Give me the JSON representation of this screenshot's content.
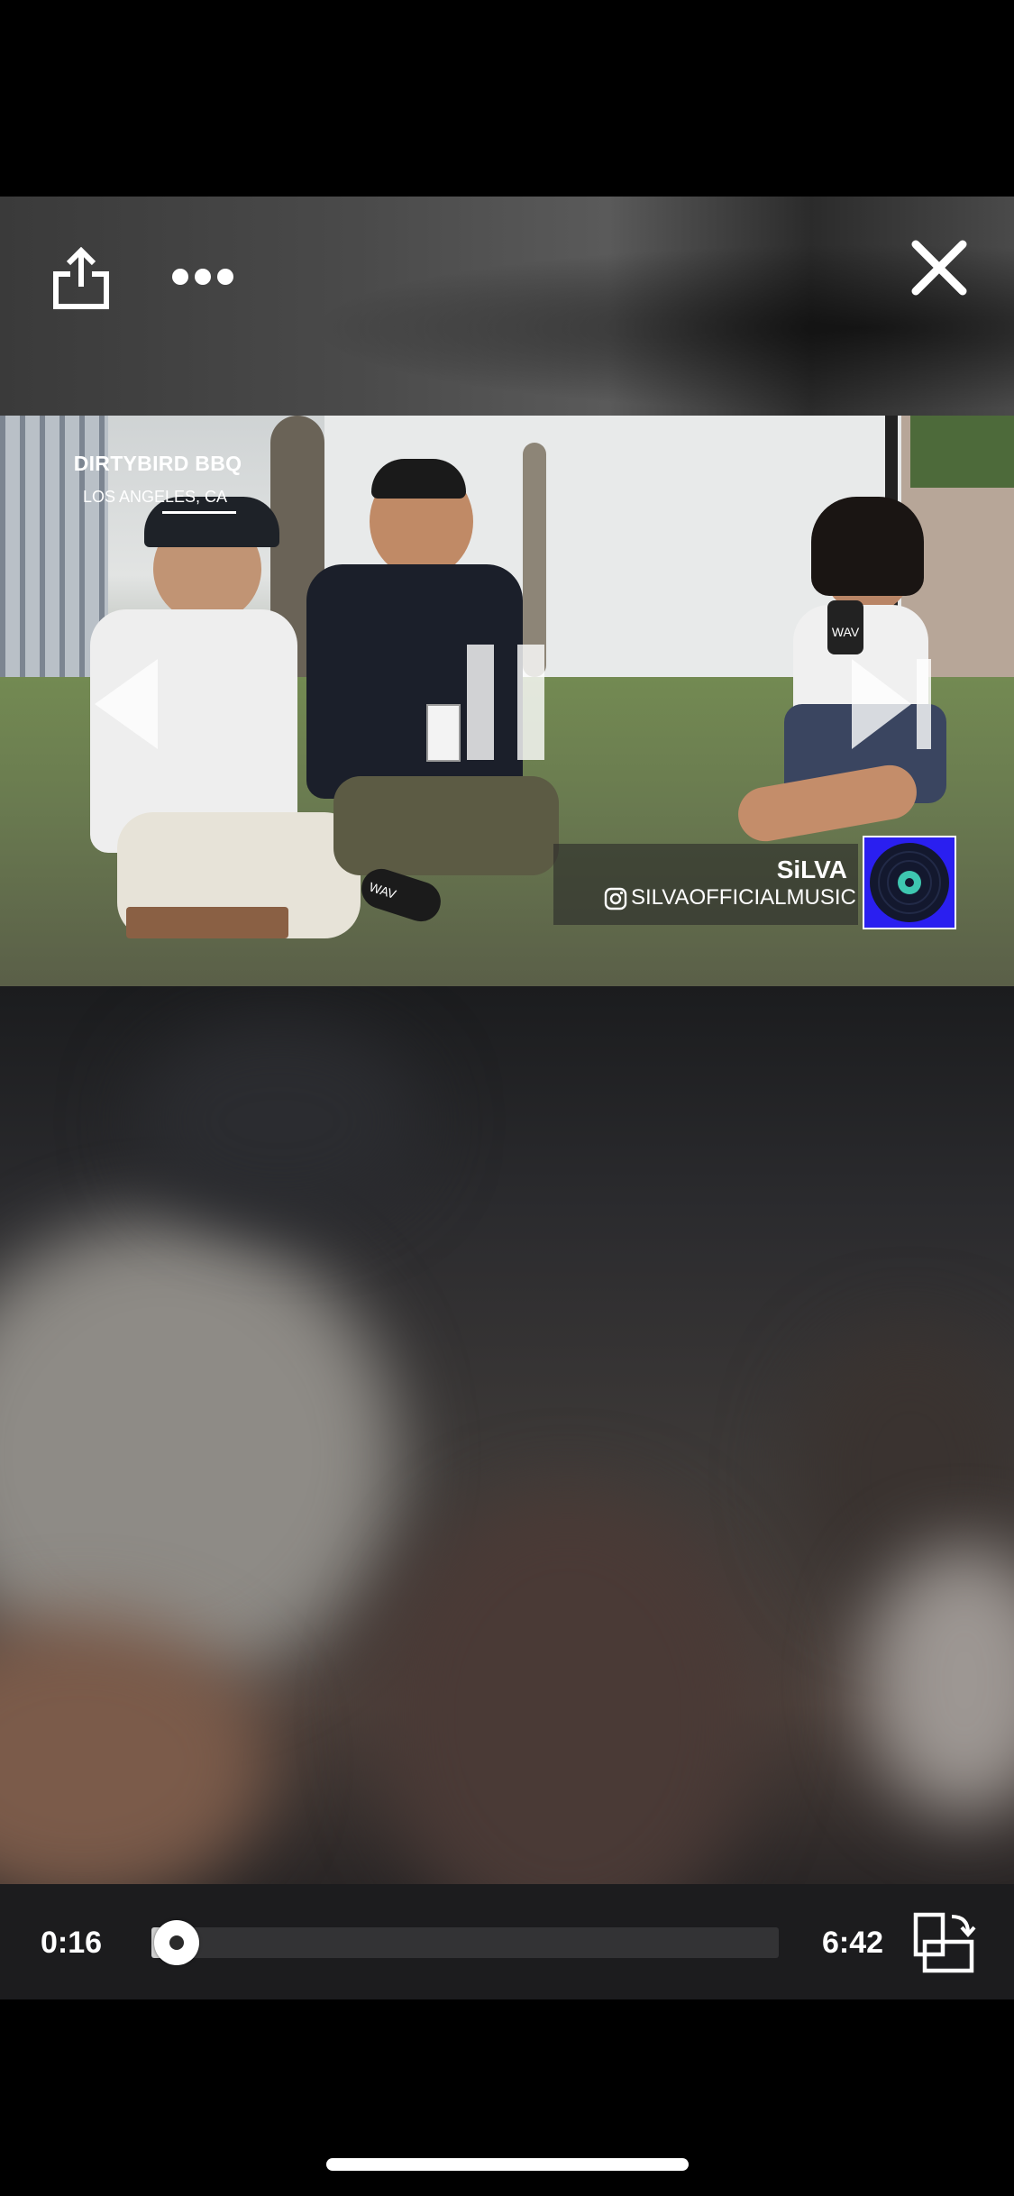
{
  "player": {
    "current_time": "0:16",
    "duration": "6:42",
    "progress_fraction": 0.04
  },
  "video_overlay": {
    "event_title": "DIRTYBIRD BBQ",
    "event_location": "LOS ANGELES, CA",
    "artist_name": "SiLVA",
    "artist_handle": "SILVAOFFICIALMUSIC",
    "mic_logo": "WAV"
  },
  "icons": {
    "share": "share-icon",
    "more": "more-icon",
    "close": "close-icon",
    "previous": "previous-icon",
    "pause": "pause-icon",
    "next": "next-icon",
    "rotate": "rotate-screen-icon",
    "instagram": "instagram-icon"
  },
  "colors": {
    "logo_bg": "#2a1ff0",
    "logo_accent": "#3ec7b0"
  }
}
